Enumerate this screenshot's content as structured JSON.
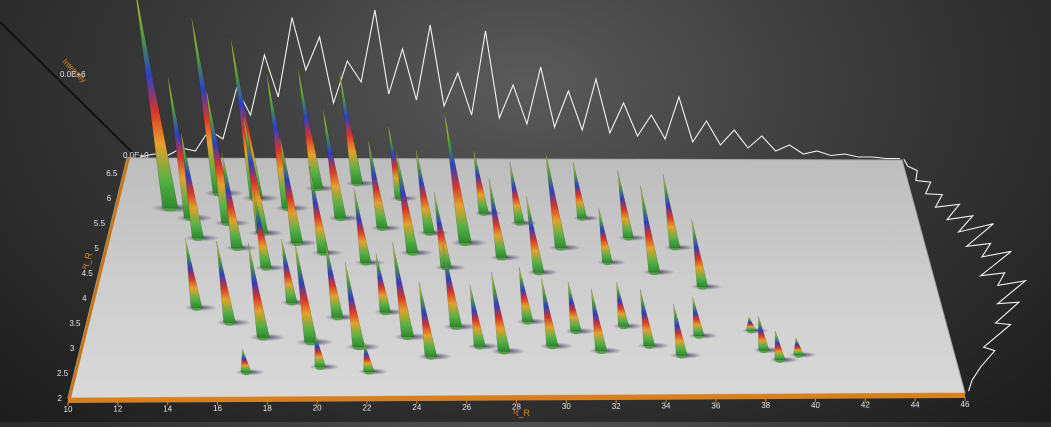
{
  "chart_data": {
    "type": "surface",
    "x_axis": {
      "label": "¹t_R",
      "range": [
        10,
        46
      ],
      "ticks": [
        10,
        12,
        14,
        16,
        18,
        20,
        22,
        24,
        26,
        28,
        30,
        32,
        34,
        36,
        38,
        40,
        42,
        44,
        46
      ]
    },
    "y_axis": {
      "label": "²t_R",
      "range": [
        2,
        6.8
      ],
      "ticks": [
        2,
        2.5,
        3,
        3.5,
        4,
        4.5,
        5,
        5.5,
        6,
        6.5
      ]
    },
    "z_axis": {
      "label": "Intensity",
      "tick_labels": [
        "0.0E+0",
        "0.0E+6"
      ]
    },
    "peaks": [
      {
        "x": 12.5,
        "y": 5.8,
        "h": 1.0
      },
      {
        "x": 13.5,
        "y": 5.6,
        "h": 0.62
      },
      {
        "x": 14.0,
        "y": 5.2,
        "h": 0.45
      },
      {
        "x": 14.6,
        "y": 6.1,
        "h": 0.8
      },
      {
        "x": 15.2,
        "y": 5.5,
        "h": 0.58
      },
      {
        "x": 15.8,
        "y": 5.0,
        "h": 0.4
      },
      {
        "x": 16.3,
        "y": 6.0,
        "h": 0.72
      },
      {
        "x": 16.8,
        "y": 5.3,
        "h": 0.5
      },
      {
        "x": 17.2,
        "y": 4.6,
        "h": 0.3
      },
      {
        "x": 17.8,
        "y": 5.8,
        "h": 0.6
      },
      {
        "x": 18.4,
        "y": 5.1,
        "h": 0.44
      },
      {
        "x": 19.0,
        "y": 6.2,
        "h": 0.55
      },
      {
        "x": 19.6,
        "y": 4.9,
        "h": 0.35
      },
      {
        "x": 20.2,
        "y": 5.6,
        "h": 0.48
      },
      {
        "x": 20.8,
        "y": 6.3,
        "h": 0.52
      },
      {
        "x": 21.5,
        "y": 4.7,
        "h": 0.3
      },
      {
        "x": 22.1,
        "y": 5.4,
        "h": 0.38
      },
      {
        "x": 22.8,
        "y": 6.0,
        "h": 0.33
      },
      {
        "x": 23.5,
        "y": 4.9,
        "h": 0.42
      },
      {
        "x": 24.2,
        "y": 5.3,
        "h": 0.36
      },
      {
        "x": 25.0,
        "y": 4.6,
        "h": 0.3
      },
      {
        "x": 25.8,
        "y": 5.1,
        "h": 0.55
      },
      {
        "x": 26.6,
        "y": 5.7,
        "h": 0.28
      },
      {
        "x": 27.4,
        "y": 4.8,
        "h": 0.32
      },
      {
        "x": 28.2,
        "y": 5.5,
        "h": 0.26
      },
      {
        "x": 29.0,
        "y": 4.5,
        "h": 0.3
      },
      {
        "x": 30.0,
        "y": 5.0,
        "h": 0.4
      },
      {
        "x": 31.0,
        "y": 5.6,
        "h": 0.24
      },
      {
        "x": 32.0,
        "y": 4.7,
        "h": 0.22
      },
      {
        "x": 33.0,
        "y": 5.2,
        "h": 0.28
      },
      {
        "x": 34.0,
        "y": 4.5,
        "h": 0.34
      },
      {
        "x": 35.0,
        "y": 5.0,
        "h": 0.3
      },
      {
        "x": 36.0,
        "y": 4.2,
        "h": 0.26
      },
      {
        "x": 14.5,
        "y": 3.8,
        "h": 0.26
      },
      {
        "x": 16.0,
        "y": 3.5,
        "h": 0.3
      },
      {
        "x": 17.5,
        "y": 3.2,
        "h": 0.34
      },
      {
        "x": 18.5,
        "y": 3.9,
        "h": 0.24
      },
      {
        "x": 19.5,
        "y": 3.1,
        "h": 0.36
      },
      {
        "x": 20.5,
        "y": 3.6,
        "h": 0.28
      },
      {
        "x": 21.5,
        "y": 3.0,
        "h": 0.3
      },
      {
        "x": 22.5,
        "y": 3.7,
        "h": 0.22
      },
      {
        "x": 23.5,
        "y": 3.2,
        "h": 0.34
      },
      {
        "x": 24.5,
        "y": 2.8,
        "h": 0.26
      },
      {
        "x": 25.5,
        "y": 3.4,
        "h": 0.3
      },
      {
        "x": 26.5,
        "y": 3.0,
        "h": 0.22
      },
      {
        "x": 27.5,
        "y": 2.9,
        "h": 0.28
      },
      {
        "x": 28.5,
        "y": 3.5,
        "h": 0.2
      },
      {
        "x": 29.5,
        "y": 3.0,
        "h": 0.24
      },
      {
        "x": 30.5,
        "y": 3.3,
        "h": 0.18
      },
      {
        "x": 31.5,
        "y": 2.9,
        "h": 0.22
      },
      {
        "x": 32.5,
        "y": 3.4,
        "h": 0.16
      },
      {
        "x": 33.5,
        "y": 3.0,
        "h": 0.2
      },
      {
        "x": 34.8,
        "y": 2.8,
        "h": 0.18
      },
      {
        "x": 35.6,
        "y": 3.2,
        "h": 0.14
      },
      {
        "x": 38.2,
        "y": 2.9,
        "h": 0.12
      },
      {
        "x": 38.8,
        "y": 2.7,
        "h": 0.1
      },
      {
        "x": 39.6,
        "y": 2.8,
        "h": 0.06
      },
      {
        "x": 37.8,
        "y": 3.3,
        "h": 0.05
      },
      {
        "x": 20.0,
        "y": 2.6,
        "h": 0.12
      },
      {
        "x": 22.0,
        "y": 2.5,
        "h": 0.1
      },
      {
        "x": 17.0,
        "y": 2.5,
        "h": 0.08
      }
    ],
    "x_profile": [
      2,
      4,
      3,
      8,
      6,
      20,
      14,
      48,
      30,
      70,
      42,
      95,
      60,
      82,
      38,
      66,
      52,
      100,
      44,
      74,
      40,
      90,
      36,
      58,
      30,
      86,
      28,
      50,
      24,
      62,
      22,
      46,
      20,
      54,
      18,
      38,
      16,
      30,
      14,
      42,
      12,
      26,
      10,
      20,
      8,
      16,
      6,
      10,
      4,
      6,
      3,
      4,
      2,
      2,
      1,
      1
    ],
    "y_profile": [
      4,
      10,
      22,
      40,
      30,
      62,
      48,
      76,
      55,
      88,
      60,
      70,
      46,
      82,
      52,
      64,
      40,
      72,
      36,
      54,
      28,
      44,
      20,
      30,
      14,
      22,
      8,
      12,
      4,
      2
    ]
  }
}
